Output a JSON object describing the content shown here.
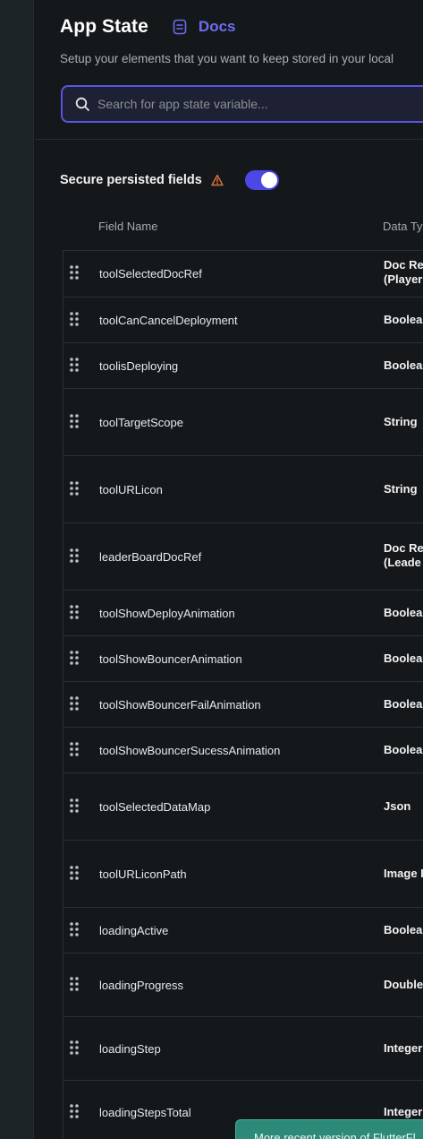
{
  "header": {
    "title": "App State",
    "docs_label": "Docs",
    "subtitle": "Setup your elements that you want to keep stored in your local"
  },
  "search": {
    "placeholder": "Search for app state variable...",
    "value": ""
  },
  "secure": {
    "label": "Secure persisted fields",
    "toggle_on": true
  },
  "table": {
    "columns": [
      "Field Name",
      "Data Ty"
    ],
    "rows": [
      {
        "name": "toolSelectedDocRef",
        "type": "Doc Re",
        "type2": "(Player"
      },
      {
        "name": "toolCanCancelDeployment",
        "type": "Boolean",
        "type2": ""
      },
      {
        "name": "toolisDeploying",
        "type": "Boolean",
        "type2": ""
      },
      {
        "name": "toolTargetScope",
        "type": "String",
        "type2": ""
      },
      {
        "name": "toolURLicon",
        "type": "String",
        "type2": ""
      },
      {
        "name": "leaderBoardDocRef",
        "type": "Doc Re",
        "type2": "(Leade"
      },
      {
        "name": "toolShowDeployAnimation",
        "type": "Boolean",
        "type2": ""
      },
      {
        "name": "toolShowBouncerAnimation",
        "type": "Boolean",
        "type2": ""
      },
      {
        "name": "toolShowBouncerFailAnimation",
        "type": "Boolean",
        "type2": ""
      },
      {
        "name": "toolShowBouncerSucessAnimation",
        "type": "Boolean",
        "type2": ""
      },
      {
        "name": "toolSelectedDataMap",
        "type": "Json",
        "type2": ""
      },
      {
        "name": "toolURLiconPath",
        "type": "Image I",
        "type2": ""
      },
      {
        "name": "loadingActive",
        "type": "Boolean",
        "type2": ""
      },
      {
        "name": "loadingProgress",
        "type": "Double",
        "type2": ""
      },
      {
        "name": "loadingStep",
        "type": "Integer",
        "type2": ""
      },
      {
        "name": "loadingStepsTotal",
        "type": "Integer",
        "type2": ""
      }
    ]
  },
  "toast": {
    "text": "More recent version of FlutterFl"
  },
  "colors": {
    "accent": "#5a55e0",
    "docs": "#6f6cf0",
    "toggle": "#4b48e6",
    "warning": "#e0703a",
    "toast": "#2e8a78"
  }
}
